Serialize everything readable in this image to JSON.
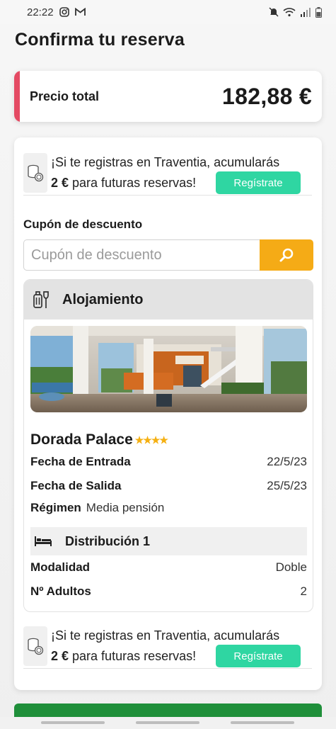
{
  "status_bar": {
    "time": "22:22",
    "icons": [
      "instagram-icon",
      "gmail-icon",
      "mute-icon",
      "wifi-icon",
      "signal-icon",
      "battery-icon"
    ]
  },
  "page": {
    "title": "Confirma tu reserva"
  },
  "price": {
    "label": "Precio total",
    "amount": "182,88 €",
    "accent_color": "#e44a63"
  },
  "promo_top": {
    "line1": "¡Si te registras en Traventia, acumularás",
    "amount": "2 €",
    "line2_rest": " para futuras reservas!",
    "button": "Regístrate",
    "icon": "coins-icon"
  },
  "coupon": {
    "title": "Cupón de descuento",
    "placeholder": "Cupón de descuento",
    "value": "",
    "search_icon": "search-icon",
    "button_color": "#f5ab16"
  },
  "accommodation": {
    "section_title": "Alojamiento",
    "section_icon": "luggage-icon",
    "hotel_name": "Dorada Palace",
    "stars": "★★★★",
    "star_count": 4,
    "check_in_label": "Fecha de Entrada",
    "check_in_value": "22/5/23",
    "check_out_label": "Fecha de Salida",
    "check_out_value": "25/5/23",
    "board_label": "Régimen",
    "board_value": "Media pensión",
    "distribution_title": "Distribución 1",
    "distribution_icon": "bed-icon",
    "room_type_label": "Modalidad",
    "room_type_value": "Doble",
    "adults_label": "Nº Adultos",
    "adults_value": "2"
  },
  "promo_bottom": {
    "line1": "¡Si te registras en Traventia, acumularás",
    "amount": "2 €",
    "line2_rest": " para futuras reservas!",
    "button": "Regístrate",
    "icon": "coins-icon"
  },
  "colors": {
    "register_button": "#2fd6a2",
    "bottom_bar": "#1f8f3a",
    "stars": "#f5b012"
  }
}
